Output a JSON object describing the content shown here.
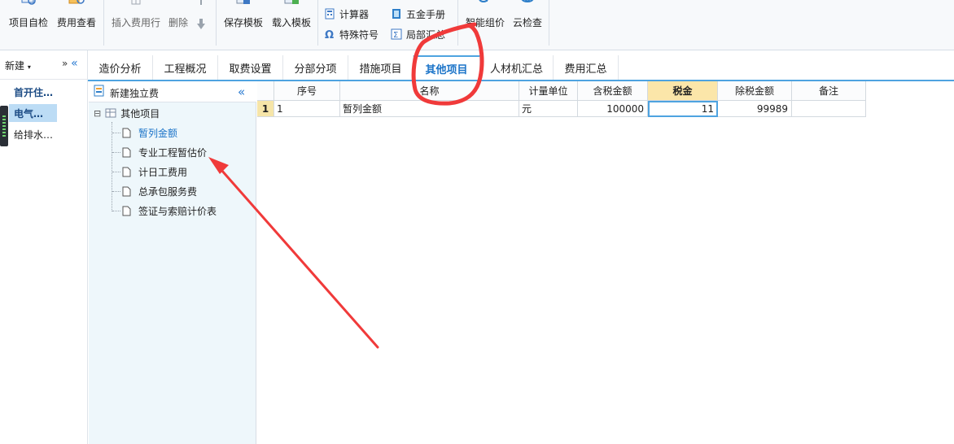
{
  "ribbon": {
    "buttons": [
      {
        "label": "项目自检"
      },
      {
        "label": "费用查看"
      },
      {
        "label": "插入费用行"
      },
      {
        "label": "删除"
      },
      {
        "label": "保存模板"
      },
      {
        "label": "载入模板"
      },
      {
        "label": "智能组价"
      },
      {
        "label": "云检查"
      }
    ],
    "small_buttons": [
      {
        "label": "计算器"
      },
      {
        "label": "特殊符号"
      },
      {
        "label": "五金手册"
      },
      {
        "label": "局部汇总"
      }
    ]
  },
  "leftnav": {
    "new_label": "新建",
    "expand_glyph": "»",
    "collapse_glyph": "«",
    "items": [
      {
        "label": "首开住…"
      },
      {
        "label": "电气…"
      },
      {
        "label": "给排水…"
      }
    ]
  },
  "tabs": [
    {
      "label": "造价分析"
    },
    {
      "label": "工程概况"
    },
    {
      "label": "取费设置"
    },
    {
      "label": "分部分项"
    },
    {
      "label": "措施项目"
    },
    {
      "label": "其他项目"
    },
    {
      "label": "人材机汇总"
    },
    {
      "label": "费用汇总"
    }
  ],
  "tree": {
    "header": "新建独立费",
    "collapse_glyph": "«",
    "root": {
      "label": "其他项目",
      "toggle": "⊟"
    },
    "children": [
      {
        "label": "暂列金额"
      },
      {
        "label": "专业工程暂估价"
      },
      {
        "label": "计日工费用"
      },
      {
        "label": "总承包服务费"
      },
      {
        "label": "签证与索赔计价表"
      }
    ]
  },
  "grid": {
    "columns": [
      "序号",
      "名称",
      "计量单位",
      "含税金额",
      "税金",
      "除税金额",
      "备注"
    ],
    "rows": [
      {
        "rownum": "1",
        "cells": [
          "1",
          "暂列金额",
          "元",
          "100000",
          "11",
          "99989",
          ""
        ]
      }
    ]
  },
  "colors": {
    "accent": "#4ea3e0",
    "active_tab_text": "#1a73c8",
    "annotation_red": "#f03a3a",
    "highlight_header": "#fbe6a9"
  }
}
